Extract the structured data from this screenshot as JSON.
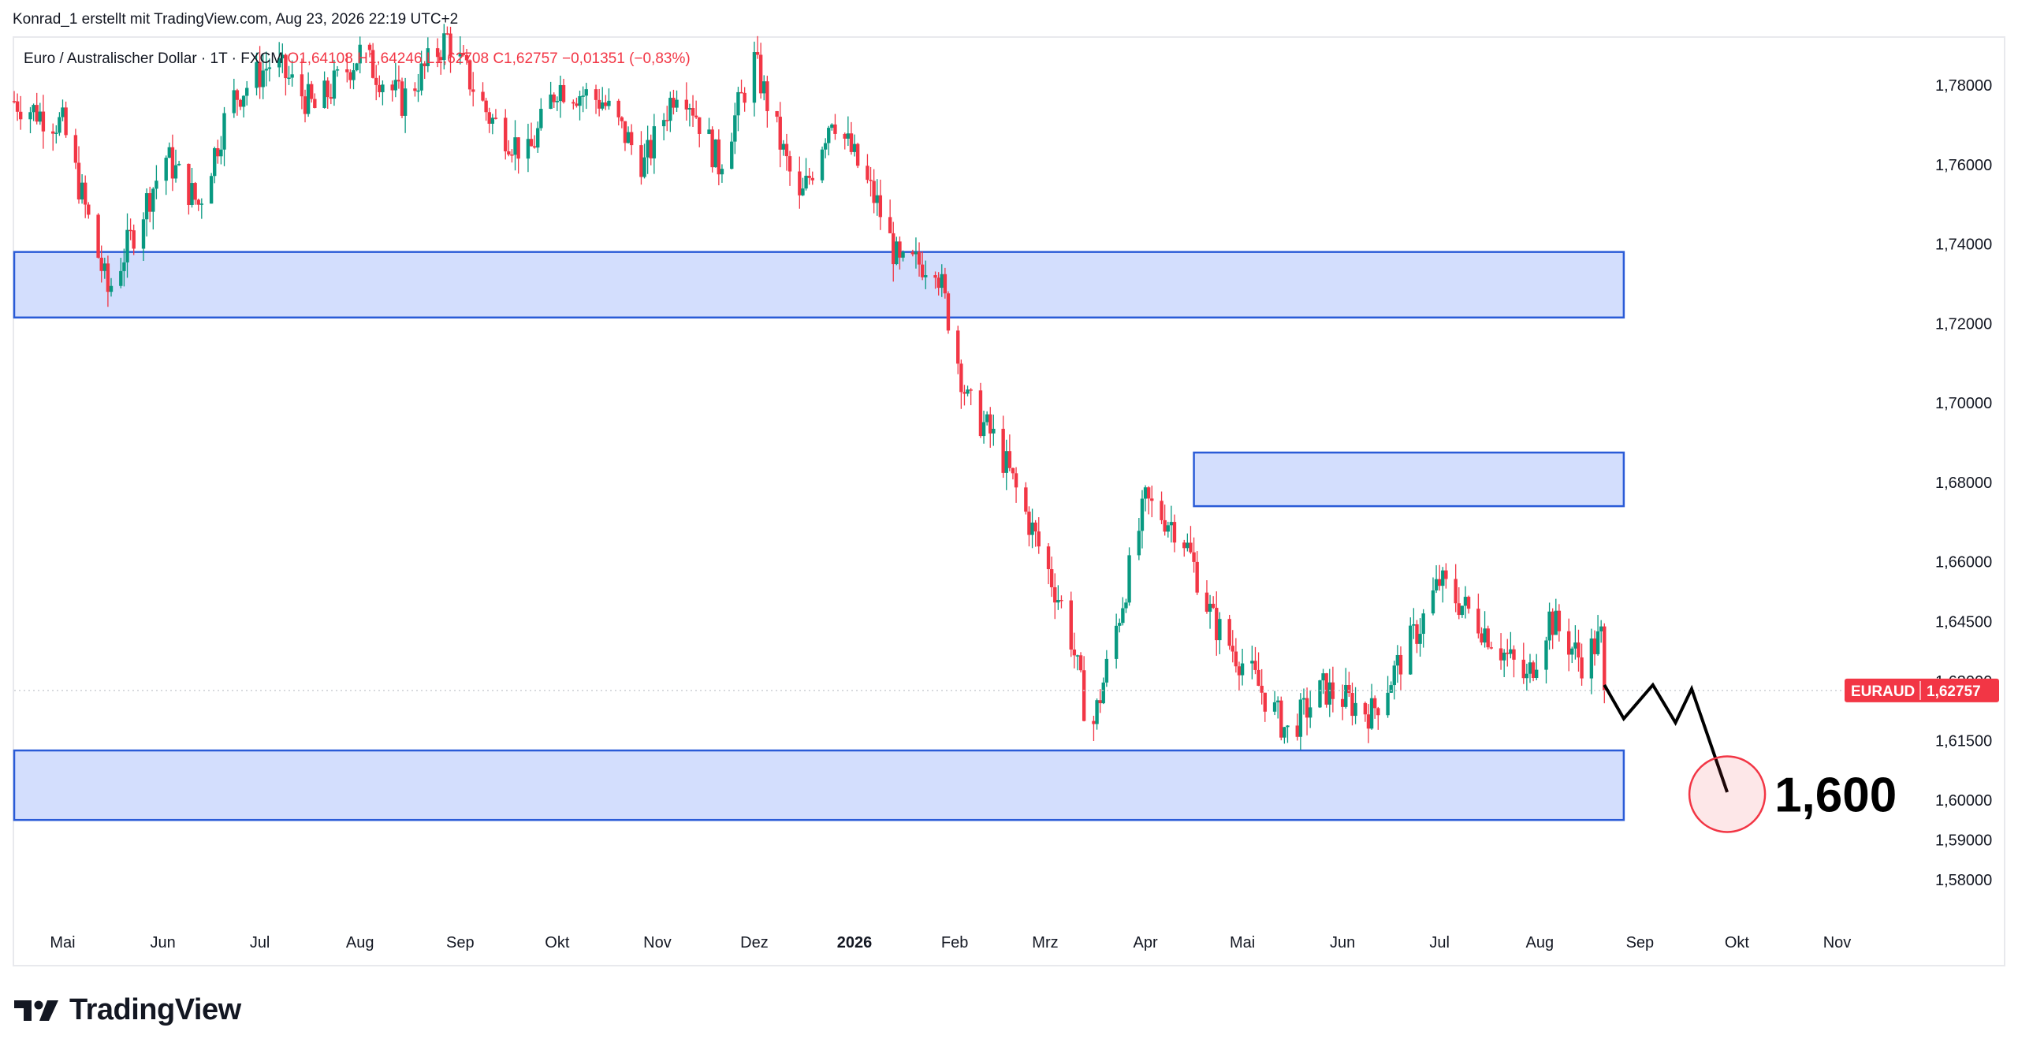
{
  "header": {
    "attribution": "Konrad_1 erstellt mit TradingView.com, Aug 23, 2026 22:19 UTC+2"
  },
  "legend": {
    "symbol": "Euro / Australischer Dollar · 1T · FXCM",
    "open": "O1,64108",
    "high": "H1,64246",
    "low": "L1,62708",
    "close": "C1,62757",
    "change": "−0,01351 (−0,83%)"
  },
  "branding": {
    "logo_text": "TradingView"
  },
  "colors": {
    "up": "#089981",
    "down": "#f23645",
    "zone_fill": "#d3defd",
    "zone_border": "#2a5bd7",
    "price_label_bg": "#f23645"
  },
  "chart_data": {
    "type": "candlestick",
    "symbol": "EURAUD",
    "last_price": "1,62757",
    "y_ticks": [
      "1,78000",
      "1,76000",
      "1,74000",
      "1,72000",
      "1,70000",
      "1,68000",
      "1,66000",
      "1,64500",
      "1,63000",
      "1,61500",
      "1,60000",
      "1,59000",
      "1,58000"
    ],
    "x_ticks": [
      {
        "label": "Mai",
        "date": "2025-05-01"
      },
      {
        "label": "Jun",
        "date": "2025-06-01"
      },
      {
        "label": "Jul",
        "date": "2025-07-01"
      },
      {
        "label": "Aug",
        "date": "2025-08-01"
      },
      {
        "label": "Sep",
        "date": "2025-09-01"
      },
      {
        "label": "Okt",
        "date": "2025-10-01"
      },
      {
        "label": "Nov",
        "date": "2025-11-01"
      },
      {
        "label": "Dez",
        "date": "2025-12-01"
      },
      {
        "label": "2026",
        "date": "2026-01-01",
        "bold": true
      },
      {
        "label": "Feb",
        "date": "2026-02-01"
      },
      {
        "label": "Mrz",
        "date": "2026-03-01"
      },
      {
        "label": "Apr",
        "date": "2026-04-01"
      },
      {
        "label": "Mai",
        "date": "2026-05-01"
      },
      {
        "label": "Jun",
        "date": "2026-06-01"
      },
      {
        "label": "Jul",
        "date": "2026-07-01"
      },
      {
        "label": "Aug",
        "date": "2026-08-01"
      },
      {
        "label": "Sep",
        "date": "2026-09-01"
      },
      {
        "label": "Okt",
        "date": "2026-10-01"
      },
      {
        "label": "Nov",
        "date": "2026-11-01"
      }
    ],
    "x_range": [
      "2025-04-16",
      "2026-11-16"
    ],
    "zones": [
      {
        "from_date": "2025-04-16",
        "to_date": "2026-08-27",
        "low": 1.7215,
        "high": 1.738
      },
      {
        "from_date": "2026-04-16",
        "to_date": "2026-08-27",
        "low": 1.674,
        "high": 1.6875
      },
      {
        "from_date": "2025-04-16",
        "to_date": "2026-08-27",
        "low": 1.595,
        "high": 1.6125
      }
    ],
    "zones_note_order": "dates per zone",
    "projection": [
      {
        "date": "2026-08-21",
        "price": 1.629
      },
      {
        "date": "2026-08-27",
        "price": 1.6205
      },
      {
        "date": "2026-09-05",
        "price": 1.629
      },
      {
        "date": "2026-09-12",
        "price": 1.6195
      },
      {
        "date": "2026-09-17",
        "price": 1.628
      },
      {
        "date": "2026-09-28",
        "price": 1.602
      }
    ],
    "target": {
      "date": "2026-09-28",
      "price": 1.6015,
      "label": "1,600"
    },
    "anchors": [
      {
        "date": "2025-04-16",
        "price": 1.776
      },
      {
        "date": "2025-05-01",
        "price": 1.77
      },
      {
        "date": "2025-05-15",
        "price": 1.728
      },
      {
        "date": "2025-05-24",
        "price": 1.745
      },
      {
        "date": "2025-06-02",
        "price": 1.762
      },
      {
        "date": "2025-06-12",
        "price": 1.75
      },
      {
        "date": "2025-06-22",
        "price": 1.776
      },
      {
        "date": "2025-07-05",
        "price": 1.786
      },
      {
        "date": "2025-07-18",
        "price": 1.774
      },
      {
        "date": "2025-08-01",
        "price": 1.788
      },
      {
        "date": "2025-08-14",
        "price": 1.776
      },
      {
        "date": "2025-08-28",
        "price": 1.792
      },
      {
        "date": "2025-09-10",
        "price": 1.772
      },
      {
        "date": "2025-09-22",
        "price": 1.762
      },
      {
        "date": "2025-10-01",
        "price": 1.78
      },
      {
        "date": "2025-10-15",
        "price": 1.776
      },
      {
        "date": "2025-10-28",
        "price": 1.76
      },
      {
        "date": "2025-11-08",
        "price": 1.782
      },
      {
        "date": "2025-11-20",
        "price": 1.76
      },
      {
        "date": "2025-12-01",
        "price": 1.786
      },
      {
        "date": "2025-12-15",
        "price": 1.75
      },
      {
        "date": "2025-12-25",
        "price": 1.773
      },
      {
        "date": "2026-01-08",
        "price": 1.75
      },
      {
        "date": "2026-01-15",
        "price": 1.734
      },
      {
        "date": "2026-01-26",
        "price": 1.736
      },
      {
        "date": "2026-02-05",
        "price": 1.7
      },
      {
        "date": "2026-02-14",
        "price": 1.69
      },
      {
        "date": "2026-02-25",
        "price": 1.668
      },
      {
        "date": "2026-03-08",
        "price": 1.645
      },
      {
        "date": "2026-03-15",
        "price": 1.616
      },
      {
        "date": "2026-03-22",
        "price": 1.64
      },
      {
        "date": "2026-04-01",
        "price": 1.675
      },
      {
        "date": "2026-04-12",
        "price": 1.668
      },
      {
        "date": "2026-04-22",
        "price": 1.645
      },
      {
        "date": "2026-05-05",
        "price": 1.63
      },
      {
        "date": "2026-05-15",
        "price": 1.617
      },
      {
        "date": "2026-05-26",
        "price": 1.628
      },
      {
        "date": "2026-06-10",
        "price": 1.622
      },
      {
        "date": "2026-06-25",
        "price": 1.644
      },
      {
        "date": "2026-07-01",
        "price": 1.655
      },
      {
        "date": "2026-07-14",
        "price": 1.644
      },
      {
        "date": "2026-07-28",
        "price": 1.63
      },
      {
        "date": "2026-08-04",
        "price": 1.646
      },
      {
        "date": "2026-08-14",
        "price": 1.635
      },
      {
        "date": "2026-08-20",
        "price": 1.641
      },
      {
        "date": "2026-08-21",
        "price": 1.6276
      }
    ]
  }
}
